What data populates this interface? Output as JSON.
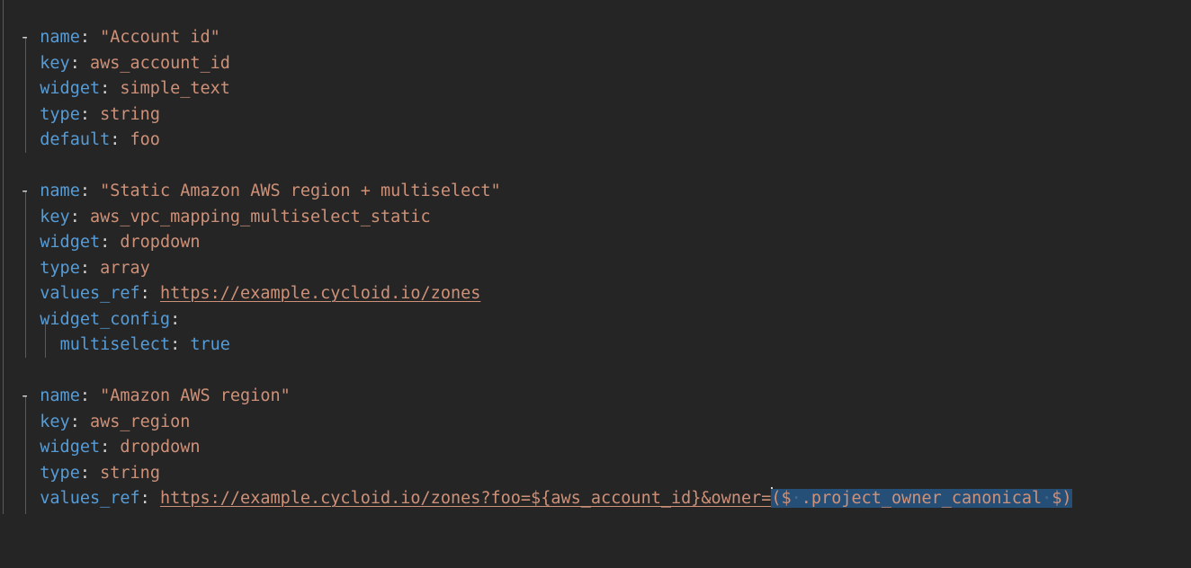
{
  "editor": {
    "language": "yaml",
    "theme": "dark",
    "colors": {
      "background": "#252526",
      "key": "#569cd6",
      "value": "#ce9178",
      "punctuation": "#d4d4d4",
      "selection": "#264f78",
      "cursor": "#d4d4d4",
      "indent_guide": "#5a5a5a"
    }
  },
  "blocks": [
    {
      "dash": "-",
      "lines": [
        {
          "key": "name",
          "colon": ":",
          "value": "\"Account id\""
        },
        {
          "key": "key",
          "colon": ":",
          "value": "aws_account_id"
        },
        {
          "key": "widget",
          "colon": ":",
          "value": "simple_text"
        },
        {
          "key": "type",
          "colon": ":",
          "value": "string"
        },
        {
          "key": "default",
          "colon": ":",
          "value": "foo"
        }
      ]
    },
    {
      "dash": "-",
      "lines": [
        {
          "key": "name",
          "colon": ":",
          "value": "\"Static Amazon AWS region + multiselect\""
        },
        {
          "key": "key",
          "colon": ":",
          "value": "aws_vpc_mapping_multiselect_static"
        },
        {
          "key": "widget",
          "colon": ":",
          "value": "dropdown"
        },
        {
          "key": "type",
          "colon": ":",
          "value": "array"
        },
        {
          "key": "values_ref",
          "colon": ":",
          "value": "https://example.cycloid.io/zones"
        },
        {
          "key": "widget_config",
          "colon": ":",
          "value": ""
        },
        {
          "key": "multiselect",
          "colon": ":",
          "value": "true"
        }
      ]
    },
    {
      "dash": "-",
      "lines": [
        {
          "key": "name",
          "colon": ":",
          "value": "\"Amazon AWS region\""
        },
        {
          "key": "key",
          "colon": ":",
          "value": "aws_region"
        },
        {
          "key": "widget",
          "colon": ":",
          "value": "dropdown"
        },
        {
          "key": "type",
          "colon": ":",
          "value": "string"
        },
        {
          "key": "values_ref",
          "colon": ":",
          "value": "https://example.cycloid.io/zones?foo=${aws_account_id}&owner="
        }
      ]
    }
  ],
  "selection": {
    "text": "($ .project_owner_canonical $)",
    "open": "($",
    "body": ".project_owner_canonical",
    "close": "$)",
    "space_dot": "·"
  }
}
